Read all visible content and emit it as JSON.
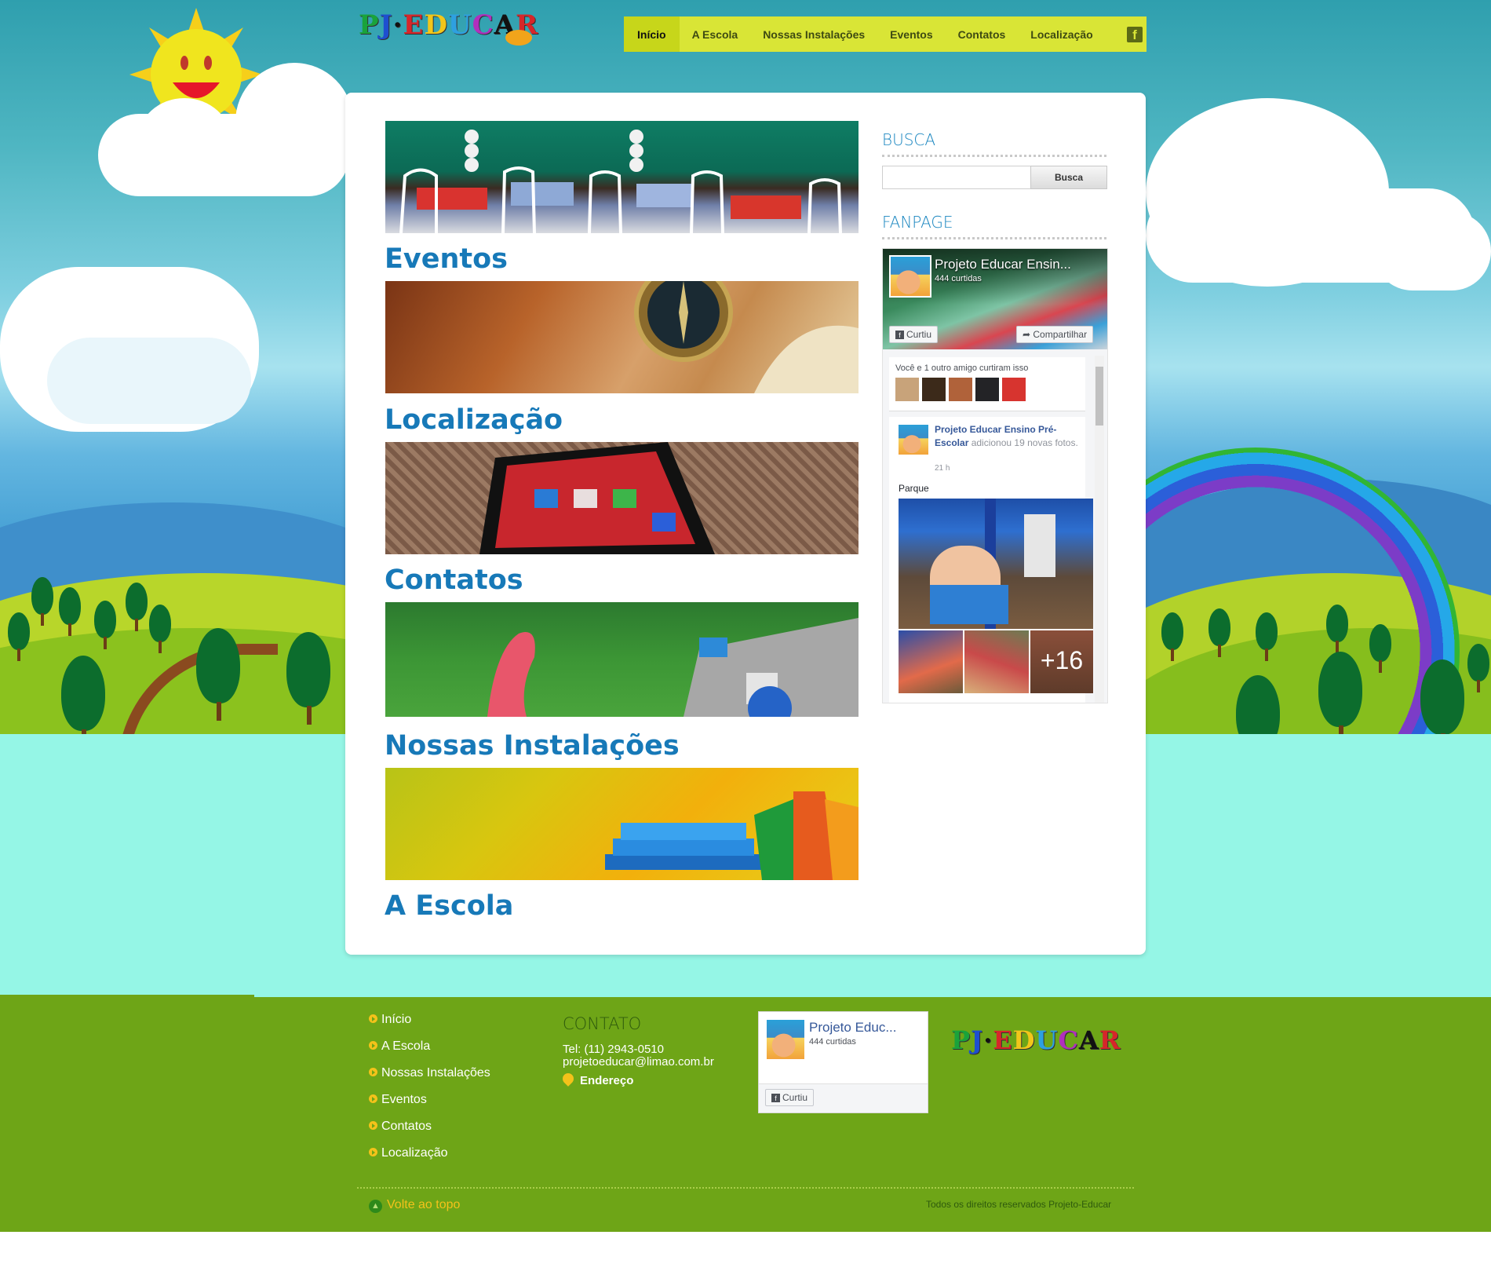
{
  "header": {
    "logo_text": "PJ·EDUCAR",
    "nav": [
      {
        "label": "Início",
        "active": true
      },
      {
        "label": "A Escola"
      },
      {
        "label": "Nossas Instalações"
      },
      {
        "label": "Eventos"
      },
      {
        "label": "Contatos"
      },
      {
        "label": "Localização"
      }
    ],
    "facebook_icon": "f"
  },
  "sections": [
    {
      "title": "Eventos"
    },
    {
      "title": "Localização"
    },
    {
      "title": "Contatos"
    },
    {
      "title": "Nossas Instalações"
    },
    {
      "title": "A Escola"
    }
  ],
  "sidebar": {
    "search_heading": "BUSCA",
    "search_button": "Busca",
    "search_value": "",
    "fanpage_heading": "FANPAGE",
    "fanpage": {
      "page_name": "Projeto Educar Ensin...",
      "likes": "444 curtidas",
      "liked_button": "Curtiu",
      "share_button": "Compartilhar",
      "friends_text": "Você e 1 outro amigo curtiram isso",
      "post_author": "Projeto Educar Ensino Pré-Escolar",
      "post_action": "adicionou 19 novas fotos.",
      "post_time": "21 h",
      "post_caption": "Parque",
      "more_photos": "+16"
    }
  },
  "footer": {
    "links": [
      "Início",
      "A Escola",
      "Nossas Instalações",
      "Eventos",
      "Contatos",
      "Localização"
    ],
    "contact_heading": "CONTATO",
    "phone": "Tel: (11) 2943-0510",
    "email": "projetoeducar@limao.com.br",
    "address_label": "Endereço",
    "fb_page_name": "Projeto Educ...",
    "fb_likes": "444 curtidas",
    "fb_liked_button": "Curtiu",
    "logo_text": "PJ·EDUCAR",
    "back_to_top": "Volte ao topo",
    "copyright": "Todos os direitos reservados Projeto-Educar"
  },
  "colors": {
    "nav_bg": "#d9e536",
    "title_blue": "#1779b8",
    "footer_green": "#6ea517",
    "aqua": "#95f6e6"
  }
}
